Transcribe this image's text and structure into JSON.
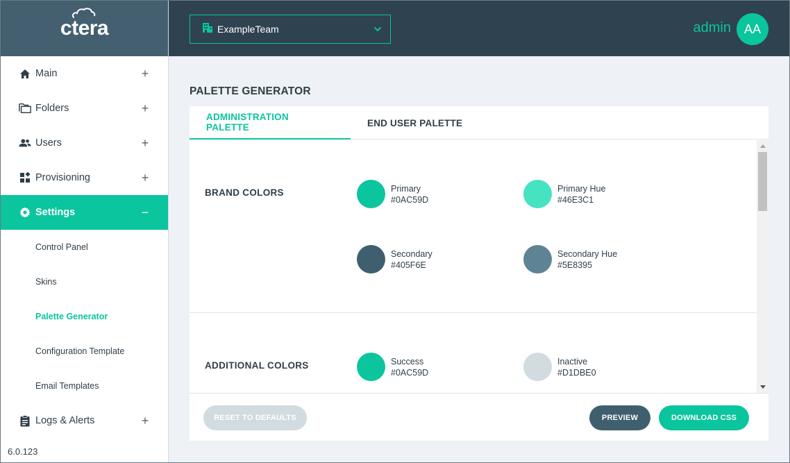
{
  "app": {
    "logo_text": "ctera",
    "version": "6.0.123"
  },
  "sidebar": {
    "items": [
      {
        "label": "Main",
        "icon": "home-icon",
        "toggle": "+"
      },
      {
        "label": "Folders",
        "icon": "folders-icon",
        "toggle": "+"
      },
      {
        "label": "Users",
        "icon": "users-icon",
        "toggle": "+"
      },
      {
        "label": "Provisioning",
        "icon": "provisioning-icon",
        "toggle": "+"
      },
      {
        "label": "Settings",
        "icon": "gear-icon",
        "toggle": "−"
      },
      {
        "label": "Logs & Alerts",
        "icon": "clipboard-icon",
        "toggle": "+"
      }
    ],
    "settings_sub": [
      {
        "label": "Control Panel"
      },
      {
        "label": "Skins"
      },
      {
        "label": "Palette Generator"
      },
      {
        "label": "Configuration Template"
      },
      {
        "label": "Email Templates"
      }
    ]
  },
  "header": {
    "team": "ExampleTeam",
    "user_name": "admin",
    "avatar_initials": "AA"
  },
  "main": {
    "title": "PALETTE GENERATOR",
    "tabs": [
      {
        "label": "ADMINISTRATION PALETTE"
      },
      {
        "label": "END USER PALETTE"
      }
    ],
    "brand": {
      "title": "BRAND COLORS",
      "swatches": [
        {
          "name": "Primary",
          "hex": "#0AC59D"
        },
        {
          "name": "Primary Hue",
          "hex": "#46E3C1"
        },
        {
          "name": "Secondary",
          "hex": "#405F6E"
        },
        {
          "name": "Secondary Hue",
          "hex": "#5E8395"
        }
      ]
    },
    "additional": {
      "title": "ADDITIONAL COLORS",
      "swatches": [
        {
          "name": "Success",
          "hex": "#0AC59D"
        },
        {
          "name": "Inactive",
          "hex": "#D1DBE0"
        }
      ]
    },
    "buttons": {
      "reset": "RESET TO DEFAULTS",
      "preview": "PREVIEW",
      "download": "DOWNLOAD CSS"
    }
  },
  "colors": {
    "accent": "#0AC59D",
    "header_bg": "#2F4250",
    "logo_bg": "#435F70",
    "page_bg": "#EEF1F5"
  }
}
